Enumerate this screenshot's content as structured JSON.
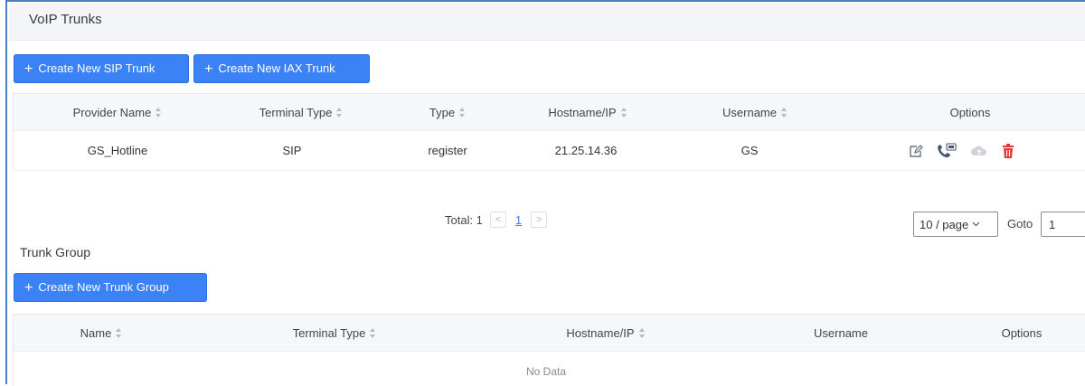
{
  "page": {
    "title": "VoIP Trunks"
  },
  "toolbar": {
    "create_sip": "Create New SIP Trunk",
    "create_iax": "Create New IAX Trunk",
    "plus": "+"
  },
  "voip_table": {
    "headers": [
      "Provider Name",
      "Terminal Type",
      "Type",
      "Hostname/IP",
      "Username",
      "Options"
    ],
    "rows": [
      {
        "provider_name": "GS_Hotline",
        "terminal_type": "SIP",
        "type": "register",
        "hostname": "21.25.14.36",
        "username": "GS"
      }
    ],
    "option_icons": [
      "edit-icon",
      "phone-dod-icon",
      "cloud-icon",
      "delete-icon"
    ]
  },
  "pagination": {
    "total_label": "Total: 1",
    "prev": "<",
    "page": "1",
    "next": ">",
    "page_size": "10 / page",
    "goto_label": "Goto",
    "goto_value": "1"
  },
  "trunk_group": {
    "title": "Trunk Group",
    "create_button": "Create New Trunk Group",
    "headers": [
      "Name",
      "Terminal Type",
      "Hostname/IP",
      "Username",
      "Options"
    ],
    "empty_text": "No Data"
  },
  "colors": {
    "accent": "#3b82f6",
    "delete": "#e53935",
    "frame": "#4a7fc1"
  }
}
